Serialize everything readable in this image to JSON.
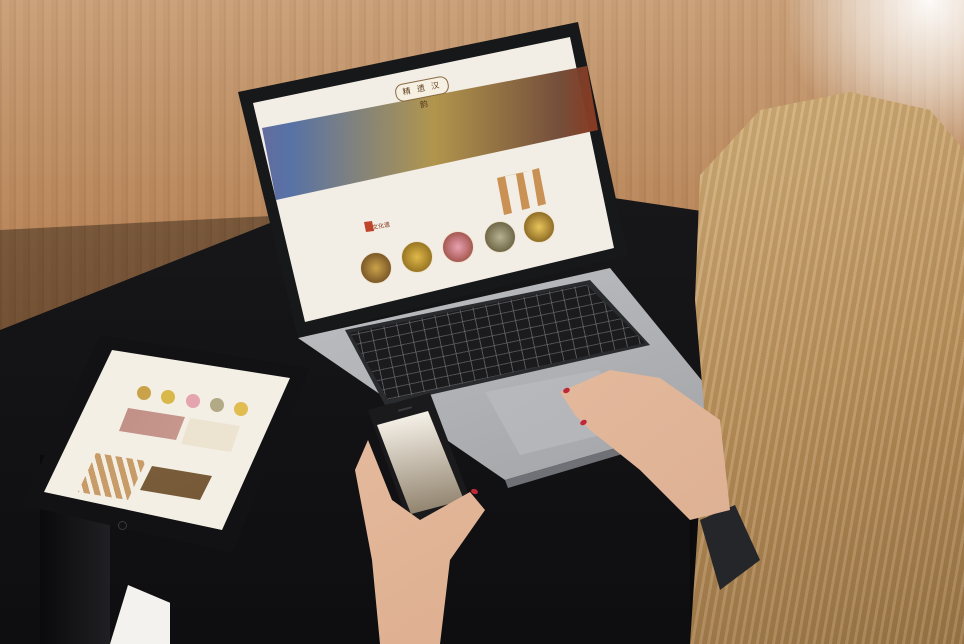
{
  "scene": {
    "description_free": true,
    "laptop": {
      "site_title": "精 遗 汉 韵",
      "brand": "文化遗"
    },
    "colors": {
      "accent": "#8a3a22",
      "wood": "#b98659",
      "table": "#141416"
    }
  }
}
